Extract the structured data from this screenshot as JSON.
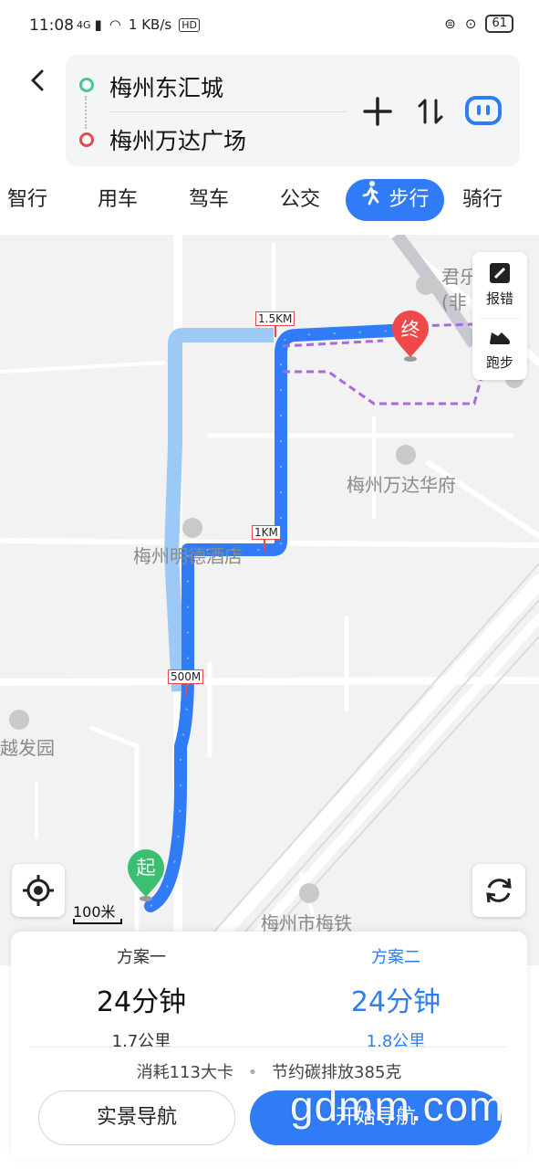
{
  "status_bar": {
    "time": "11:08",
    "network": "4G",
    "speed": "1 KB/s",
    "hd": "HD",
    "battery": "61"
  },
  "header": {
    "from": "梅州东汇城",
    "to": "梅州万达广场"
  },
  "tabs": [
    {
      "label": "智行"
    },
    {
      "label": "用车"
    },
    {
      "label": "驾车"
    },
    {
      "label": "公交"
    },
    {
      "label": "步行",
      "active": true
    },
    {
      "label": "骑行"
    }
  ],
  "map": {
    "labels": {
      "hotel_top": "君乐",
      "hotel_top2": "(非",
      "wanda_fu": "梅州万达华府",
      "mingde": "梅州明德酒店",
      "fayuan": "越发园",
      "meitie": "梅州市梅铁"
    },
    "distance_marks": [
      "1.5KM",
      "1KM",
      "500M"
    ],
    "start_marker": "起",
    "end_marker": "终",
    "side_panel": {
      "report": "报错",
      "run": "跑步"
    },
    "scale": "100米"
  },
  "plans": [
    {
      "name": "方案一",
      "time": "24分钟",
      "distance": "1.7公里"
    },
    {
      "name": "方案二",
      "time": "24分钟",
      "distance": "1.8公里",
      "active": true
    }
  ],
  "summary": {
    "calories": "消耗113大卡",
    "dot": "•",
    "carbon": "节约碳排放385克"
  },
  "buttons": {
    "live_nav": "实景导航",
    "start_nav": "开始导航"
  },
  "watermark": "gdmm.com"
}
